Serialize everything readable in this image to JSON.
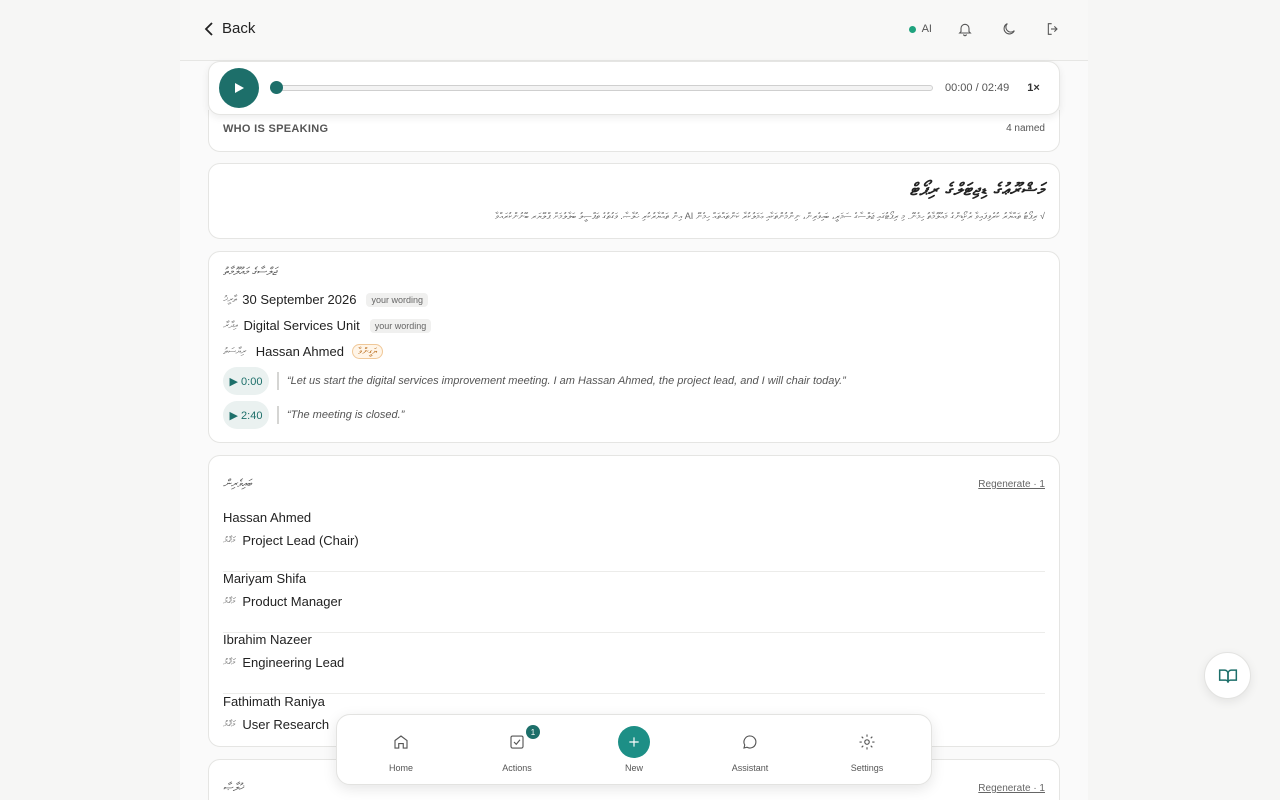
{
  "header": {
    "back_label": "Back",
    "ai_label": "AI"
  },
  "player": {
    "current_time": "00:00",
    "total_time": "02:49",
    "time_separator": " / ",
    "speed": "1×",
    "progress_fraction": 0
  },
  "speaking": {
    "label": "WHO IS SPEAKING",
    "count": "4 named"
  },
  "title_card": {
    "title": "މަޝްރޫޢުގެ ޑިޖިޓަލްގެ ރިޕޯޓް",
    "description": "√ ރިޕޯޓު ތައްޔާރު ކުރެވިފައިވާ ރެކޯޑިންގެ މައުލޫމާތު ހިމެނޭ. މި ރިޕޯޓުގައި ޖަލްސާގެ ސަމަރީ، ބައިވެރިން، ނިންމުންތަކާއި ޢަމަލުކުރާ ކަންތައްތައް ހިމެނޭ AI އިން ތައްޔާރުކުރި ޚުލާޞާ. ވަގުތުގެ ތަފްސީލު ބަލާލުމަށް ޕްލޭޔަރ ބޭނުންކުރައްވާ"
  },
  "meta": {
    "heading": "ޖަލްސާގެ މައުލޫމާތު",
    "date_label": "ތާރީޚު",
    "date_value": "30 September 2026",
    "date_tag": "your wording",
    "org_label": "އިދާރާ",
    "org_value": "Digital Services Unit",
    "org_tag": "your wording",
    "chair_label": "ރިޔާސަތު",
    "chair_value": "Hassan Ahmed",
    "chair_tag": "ޔަގީންވާ",
    "quotes": [
      {
        "timestamp": "▶ 0:00",
        "text": "“Let us start the digital services improvement meeting. I am Hassan Ahmed, the project lead, and I will chair today.”"
      },
      {
        "timestamp": "▶ 2:40",
        "text": "“The meeting is closed.”"
      }
    ]
  },
  "attendees": {
    "heading": "ބައިވެރިން",
    "regenerate_label": "Regenerate · 1",
    "role_label": "މަޤާމު",
    "items": [
      {
        "name": "Hassan Ahmed",
        "role": "Project Lead (Chair)"
      },
      {
        "name": "Mariyam Shifa",
        "role": "Product Manager"
      },
      {
        "name": "Ibrahim Nazeer",
        "role": "Engineering Lead"
      },
      {
        "name": "Fathimath Raniya",
        "role": "User Research"
      }
    ]
  },
  "next_section": {
    "heading": "ޚުލާޞާ",
    "regenerate_label": "Regenerate · 1"
  },
  "bottom_nav": {
    "home": "Home",
    "actions": "Actions",
    "actions_badge": "1",
    "new": "New",
    "assistant": "Assistant",
    "settings": "Settings"
  },
  "colors": {
    "accent": "#1d6f6a",
    "accent_bright": "#1d8f86",
    "ai_dot": "#1fa37e"
  }
}
